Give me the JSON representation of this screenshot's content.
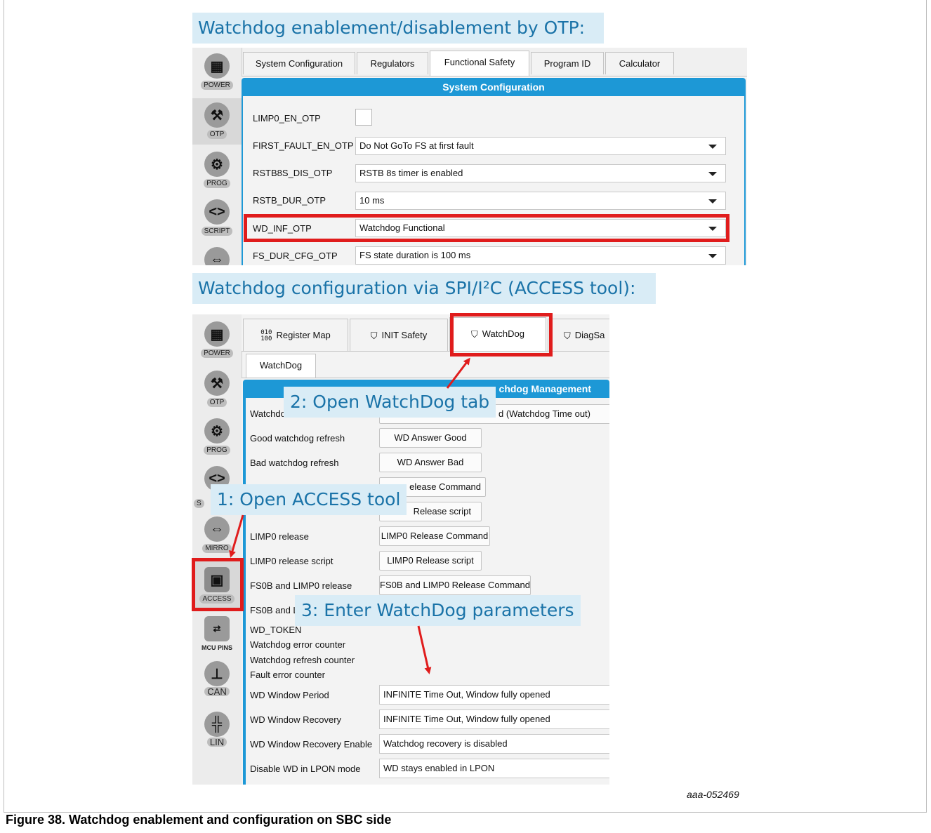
{
  "figure": {
    "caption": "Figure 38.  Watchdog enablement and configuration on SBC side",
    "figure_id": "aaa-052469"
  },
  "headings": {
    "otp": "Watchdog enablement/disablement by OTP:",
    "access": "Watchdog configuration via SPI/I²C (ACCESS tool):"
  },
  "callouts": {
    "step1": "1: Open ACCESS tool",
    "step2": "2: Open WatchDog tab",
    "step3": "3: Enter WatchDog parameters"
  },
  "otp_panel": {
    "sidebar": [
      "POWER",
      "OTP",
      "PROG",
      "SCRIPT"
    ],
    "tabs": [
      "System Configuration",
      "Regulators",
      "Functional Safety",
      "Program ID",
      "Calculator"
    ],
    "active_tab": "Functional Safety",
    "section_title": "System Configuration",
    "rows": [
      {
        "label": "LIMP0_EN_OTP",
        "value": ""
      },
      {
        "label": "FIRST_FAULT_EN_OTP",
        "value": "Do Not GoTo FS at first fault"
      },
      {
        "label": "RSTB8S_DIS_OTP",
        "value": "RSTB 8s timer is enabled"
      },
      {
        "label": "RSTB_DUR_OTP",
        "value": "10 ms"
      },
      {
        "label": "WD_INF_OTP",
        "value": "Watchdog Functional"
      },
      {
        "label": "FS_DUR_CFG_OTP",
        "value": "FS state duration is 100 ms"
      }
    ]
  },
  "access_panel": {
    "sidebar": [
      "POWER",
      "OTP",
      "PROG",
      "S",
      "MIRRO",
      "ACCESS",
      "MCU PINS",
      "CAN",
      "LIN"
    ],
    "tabs": [
      "Register Map",
      "INIT Safety",
      "WatchDog",
      "DiagSa"
    ],
    "subtab": "WatchDog",
    "section_title": "chdog Management",
    "rows": [
      {
        "label": "Watchdo",
        "button": "d (Watchdog Time out)"
      },
      {
        "label": "Good watchdog refresh",
        "button": "WD Answer Good"
      },
      {
        "label": "Bad watchdog refresh",
        "button": "WD Answer Bad"
      },
      {
        "label": "",
        "button": "elease Command"
      },
      {
        "label": "",
        "button": "Release script"
      },
      {
        "label": "LIMP0 release",
        "button": "LIMP0 Release Command"
      },
      {
        "label": "LIMP0 release script",
        "button": "LIMP0 Release script"
      },
      {
        "label": "FS0B and LIMP0 release",
        "button": "FS0B and LIMP0 Release Command"
      },
      {
        "label": "FS0B and L",
        "button": ""
      }
    ],
    "counters": [
      "WD_TOKEN",
      "Watchdog error counter",
      "Watchdog refresh counter",
      "Fault error counter"
    ],
    "combos": [
      {
        "label": "WD Window Period",
        "value": "INFINITE Time Out, Window fully opened"
      },
      {
        "label": "WD Window Recovery",
        "value": "INFINITE Time Out, Window fully opened"
      },
      {
        "label": "WD Window Recovery Enable",
        "value": "Watchdog recovery is disabled"
      },
      {
        "label": "Disable WD in LPON mode",
        "value": "WD stays enabled in LPON"
      }
    ]
  },
  "colors": {
    "highlight": "#e01c1c",
    "accent": "#1d98d6",
    "callout_bg": "#d9ecf6",
    "callout_text": "#1a73a8"
  }
}
